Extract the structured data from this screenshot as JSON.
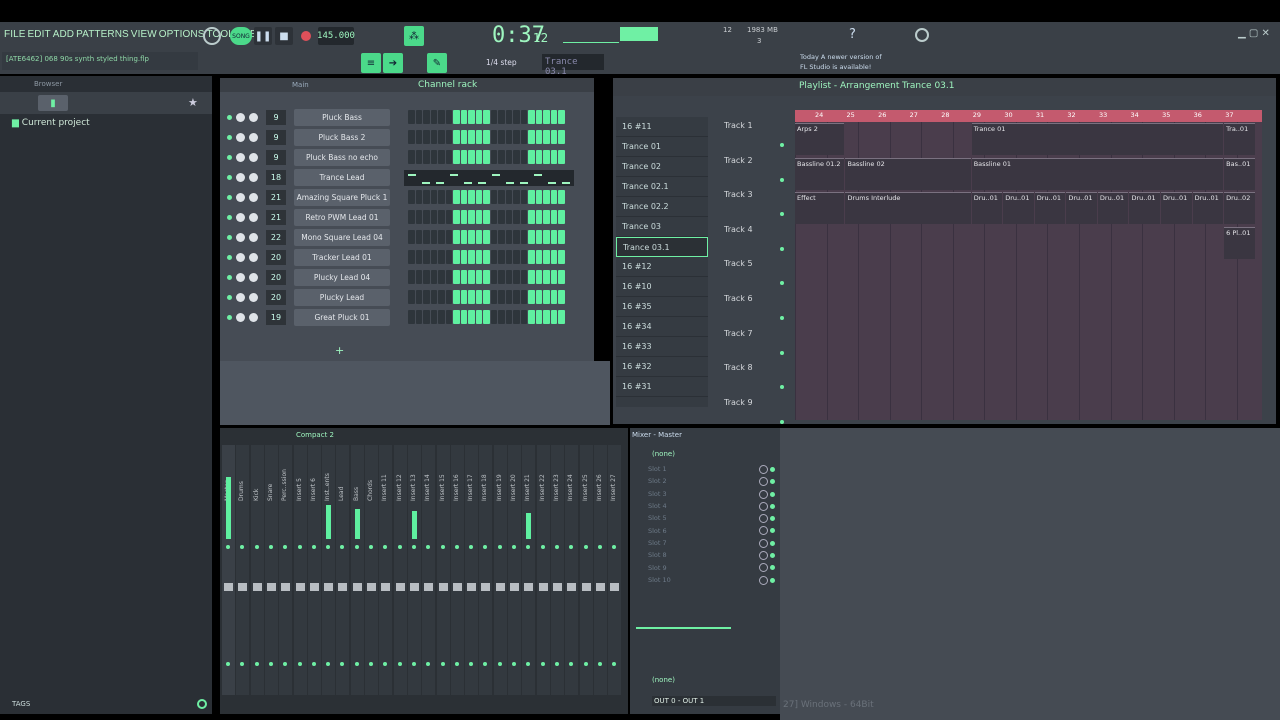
{
  "menu": [
    "FILE",
    "EDIT",
    "ADD",
    "PATTERNS",
    "VIEW",
    "OPTIONS",
    "TOOLS",
    "HELP"
  ],
  "project_file": "[ATE6462] 068 90s synth styled thing.flp",
  "transport": {
    "mode": "SONG",
    "tempo": "145.000",
    "time": "0:37",
    "time_sub": "12",
    "cpu": "12",
    "memory": "1983 MB",
    "voices": "3",
    "step": "1/4 step",
    "pattern": "Trance 03.1"
  },
  "news": {
    "line1": "Today  A newer version of",
    "line2": "FL Studio is available!"
  },
  "browser": {
    "title": "Browser",
    "item": "Current project",
    "tags": "TAGS"
  },
  "channel_rack": {
    "title": "Channel rack",
    "group": "Main",
    "add": "+",
    "channels": [
      {
        "num": "9",
        "name": "Pluck Bass",
        "steps": [
          0,
          0,
          0,
          0,
          0,
          0,
          1,
          1,
          1,
          1,
          1,
          0,
          0,
          0,
          0,
          0,
          1,
          1,
          1,
          1,
          1
        ]
      },
      {
        "num": "9",
        "name": "Pluck Bass 2",
        "steps": [
          0,
          0,
          0,
          0,
          0,
          0,
          1,
          1,
          1,
          1,
          1,
          0,
          0,
          0,
          0,
          0,
          1,
          1,
          1,
          1,
          1
        ]
      },
      {
        "num": "9",
        "name": "Pluck Bass no echo",
        "steps": [
          0,
          0,
          0,
          0,
          0,
          0,
          1,
          1,
          1,
          1,
          1,
          0,
          0,
          0,
          0,
          0,
          1,
          1,
          1,
          1,
          1
        ]
      },
      {
        "num": "18",
        "name": "Trance Lead",
        "steps": "roll"
      },
      {
        "num": "21",
        "name": "Amazing Square Pluck 1",
        "steps": [
          0,
          0,
          0,
          0,
          0,
          0,
          1,
          1,
          1,
          1,
          1,
          0,
          0,
          0,
          0,
          0,
          1,
          1,
          1,
          1,
          1
        ]
      },
      {
        "num": "21",
        "name": "Retro PWM Lead 01",
        "steps": [
          0,
          0,
          0,
          0,
          0,
          0,
          1,
          1,
          1,
          1,
          1,
          0,
          0,
          0,
          0,
          0,
          1,
          1,
          1,
          1,
          1
        ]
      },
      {
        "num": "22",
        "name": "Mono Square Lead 04",
        "steps": [
          0,
          0,
          0,
          0,
          0,
          0,
          1,
          1,
          1,
          1,
          1,
          0,
          0,
          0,
          0,
          0,
          1,
          1,
          1,
          1,
          1
        ]
      },
      {
        "num": "20",
        "name": "Tracker Lead 01",
        "steps": [
          0,
          0,
          0,
          0,
          0,
          0,
          1,
          1,
          1,
          1,
          1,
          0,
          0,
          0,
          0,
          0,
          1,
          1,
          1,
          1,
          1
        ]
      },
      {
        "num": "20",
        "name": "Plucky Lead 04",
        "steps": [
          0,
          0,
          0,
          0,
          0,
          0,
          1,
          1,
          1,
          1,
          1,
          0,
          0,
          0,
          0,
          0,
          1,
          1,
          1,
          1,
          1
        ]
      },
      {
        "num": "20",
        "name": "Plucky Lead",
        "steps": [
          0,
          0,
          0,
          0,
          0,
          0,
          1,
          1,
          1,
          1,
          1,
          0,
          0,
          0,
          0,
          0,
          1,
          1,
          1,
          1,
          1
        ]
      },
      {
        "num": "19",
        "name": "Great Pluck 01",
        "steps": [
          0,
          0,
          0,
          0,
          0,
          0,
          1,
          1,
          1,
          1,
          1,
          0,
          0,
          0,
          0,
          0,
          1,
          1,
          1,
          1,
          1
        ]
      }
    ]
  },
  "playlist": {
    "title": "Playlist - Arrangement",
    "pattern": "Trance 03.1",
    "patterns": [
      "16 #11",
      "Trance 01",
      "Trance 02",
      "Trance 02.1",
      "Trance 02.2",
      "Trance 03",
      "Trance 03.1",
      "16 #12",
      "16 #10",
      "16 #35",
      "16 #34",
      "16 #33",
      "16 #32",
      "16 #31"
    ],
    "selected_pattern": "Trance 03.1",
    "tracks": [
      "Track 1",
      "Track 2",
      "Track 3",
      "Track 4",
      "Track 5",
      "Track 6",
      "Track 7",
      "Track 8",
      "Track 9"
    ],
    "bars": [
      "24",
      "25",
      "26",
      "27",
      "28",
      "29",
      "30",
      "31",
      "32",
      "33",
      "34",
      "35",
      "36",
      "37"
    ],
    "clips": [
      {
        "track": 0,
        "start": 0,
        "len": 1.6,
        "label": "Arps 2"
      },
      {
        "track": 0,
        "start": 5.6,
        "len": 8,
        "label": "Trance 01"
      },
      {
        "track": 0,
        "start": 13.6,
        "len": 1,
        "label": "Tra..01"
      },
      {
        "track": 1,
        "start": 0,
        "len": 1.6,
        "label": "Bassline 01.2"
      },
      {
        "track": 1,
        "start": 1.6,
        "len": 4,
        "label": "Bassline 02"
      },
      {
        "track": 1,
        "start": 5.6,
        "len": 8,
        "label": "Bassline 01"
      },
      {
        "track": 1,
        "start": 13.6,
        "len": 1,
        "label": "Bas..01"
      },
      {
        "track": 2,
        "start": 0,
        "len": 1.6,
        "label": "Effect"
      },
      {
        "track": 2,
        "start": 1.6,
        "len": 4,
        "label": "Drums Interlude"
      },
      {
        "track": 2,
        "start": 5.6,
        "len": 1,
        "label": "Dru..01"
      },
      {
        "track": 2,
        "start": 6.6,
        "len": 1,
        "label": "Dru..01"
      },
      {
        "track": 2,
        "start": 7.6,
        "len": 1,
        "label": "Dru..01"
      },
      {
        "track": 2,
        "start": 8.6,
        "len": 1,
        "label": "Dru..01"
      },
      {
        "track": 2,
        "start": 9.6,
        "len": 1,
        "label": "Dru..01"
      },
      {
        "track": 2,
        "start": 10.6,
        "len": 1,
        "label": "Dru..01"
      },
      {
        "track": 2,
        "start": 11.6,
        "len": 1,
        "label": "Dru..01"
      },
      {
        "track": 2,
        "start": 12.6,
        "len": 1,
        "label": "Dru..01"
      },
      {
        "track": 2,
        "start": 13.6,
        "len": 1,
        "label": "Dru..02"
      },
      {
        "track": 3,
        "start": 13.6,
        "len": 1,
        "label": "6 Pl..01"
      }
    ]
  },
  "mixer": {
    "title": "Compact 2",
    "master_title": "Mixer - Master",
    "insert_labels": [
      "Master",
      "Drums",
      "Kick",
      "Snare",
      "Perc..ssion",
      "Insert 5",
      "Insert 6",
      "Inst..ents",
      "Lead",
      "Bass",
      "Chords",
      "Insert 11",
      "Insert 12",
      "Insert 13",
      "Insert 14",
      "Insert 15",
      "Insert 16",
      "Insert 17",
      "Insert 18",
      "Insert 19",
      "Insert 20",
      "Insert 21",
      "Insert 22",
      "Insert 23",
      "Insert 24",
      "Insert 25",
      "Insert 26",
      "Insert 27"
    ],
    "slots": [
      "Slot 1",
      "Slot 2",
      "Slot 3",
      "Slot 4",
      "Slot 5",
      "Slot 6",
      "Slot 7",
      "Slot 8",
      "Slot 9",
      "Slot 10"
    ],
    "input": "(none)",
    "output": "(none)",
    "out_route": "OUT 0 - OUT 1"
  },
  "statusbar": "27] Windows - 64Bit"
}
